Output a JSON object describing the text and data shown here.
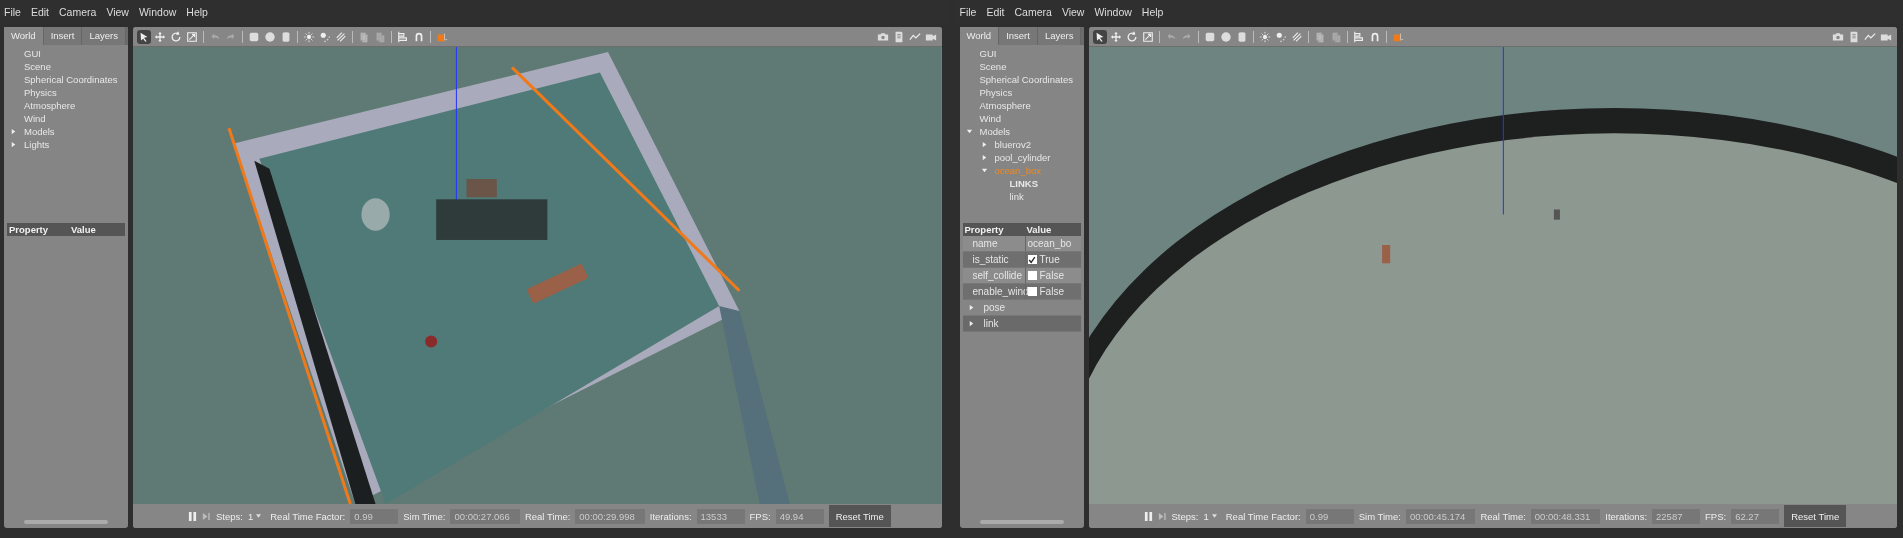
{
  "windows": [
    {
      "menu": [
        "File",
        "Edit",
        "Camera",
        "View",
        "Window",
        "Help"
      ],
      "tabs": [
        {
          "label": "World",
          "selected": true
        },
        {
          "label": "Insert",
          "selected": false
        },
        {
          "label": "Layers",
          "selected": false
        }
      ],
      "tree": [
        {
          "label": "GUI"
        },
        {
          "label": "Scene"
        },
        {
          "label": "Spherical Coordinates"
        },
        {
          "label": "Physics"
        },
        {
          "label": "Atmosphere"
        },
        {
          "label": "Wind"
        },
        {
          "label": "Models",
          "expanded": false
        },
        {
          "label": "Lights",
          "expanded": false
        }
      ],
      "property_table": {
        "columns": [
          "Property",
          "Value"
        ]
      },
      "status_bar": {
        "paused": false,
        "steps_label": "Steps:",
        "steps": "1",
        "fields": [
          {
            "label": "Real Time Factor:",
            "value": "0.99"
          },
          {
            "label": "Sim Time:",
            "value": "00:00:27.066"
          },
          {
            "label": "Real Time:",
            "value": "00:00:29.998"
          },
          {
            "label": "Iterations:",
            "value": "13533"
          },
          {
            "label": "FPS:",
            "value": "49.94"
          }
        ],
        "reset_button": "Reset Time"
      }
    },
    {
      "menu": [
        "File",
        "Edit",
        "Camera",
        "View",
        "Window",
        "Help"
      ],
      "tabs": [
        {
          "label": "World",
          "selected": true
        },
        {
          "label": "Insert",
          "selected": false
        },
        {
          "label": "Layers",
          "selected": false
        }
      ],
      "tree": [
        {
          "label": "GUI"
        },
        {
          "label": "Scene"
        },
        {
          "label": "Spherical Coordinates"
        },
        {
          "label": "Physics"
        },
        {
          "label": "Atmosphere"
        },
        {
          "label": "Wind"
        },
        {
          "label": "Models",
          "expanded": true,
          "children": [
            {
              "label": "bluerov2",
              "expanded": false,
              "selected": false
            },
            {
              "label": "pool_cylinder",
              "expanded": false,
              "selected": false
            },
            {
              "label": "ocean_box",
              "expanded": true,
              "selected": true,
              "children": [
                {
                  "label": "LINKS",
                  "kind": "heading"
                },
                {
                  "label": "link",
                  "kind": "item"
                }
              ]
            }
          ]
        }
      ],
      "property_table": {
        "columns": [
          "Property",
          "Value"
        ],
        "rows": [
          {
            "kind": "text",
            "name": "name",
            "value": "ocean_bo"
          },
          {
            "kind": "bool",
            "name": "is_static",
            "checked": true,
            "value": "True"
          },
          {
            "kind": "bool",
            "name": "self_collide",
            "checked": false,
            "value": "False"
          },
          {
            "kind": "bool",
            "name": "enable_wind",
            "checked": false,
            "value": "False"
          },
          {
            "kind": "group",
            "name": "pose",
            "expanded": false
          },
          {
            "kind": "group",
            "name": "link",
            "expanded": false
          }
        ]
      },
      "status_bar": {
        "paused": false,
        "steps_label": "Steps:",
        "steps": "1",
        "fields": [
          {
            "label": "Real Time Factor:",
            "value": "0.99"
          },
          {
            "label": "Sim Time:",
            "value": "00:00:45.174"
          },
          {
            "label": "Real Time:",
            "value": "00:00:48.331"
          },
          {
            "label": "Iterations:",
            "value": "22587"
          },
          {
            "label": "FPS:",
            "value": "62.27"
          }
        ],
        "reset_button": "Reset Time"
      }
    }
  ]
}
